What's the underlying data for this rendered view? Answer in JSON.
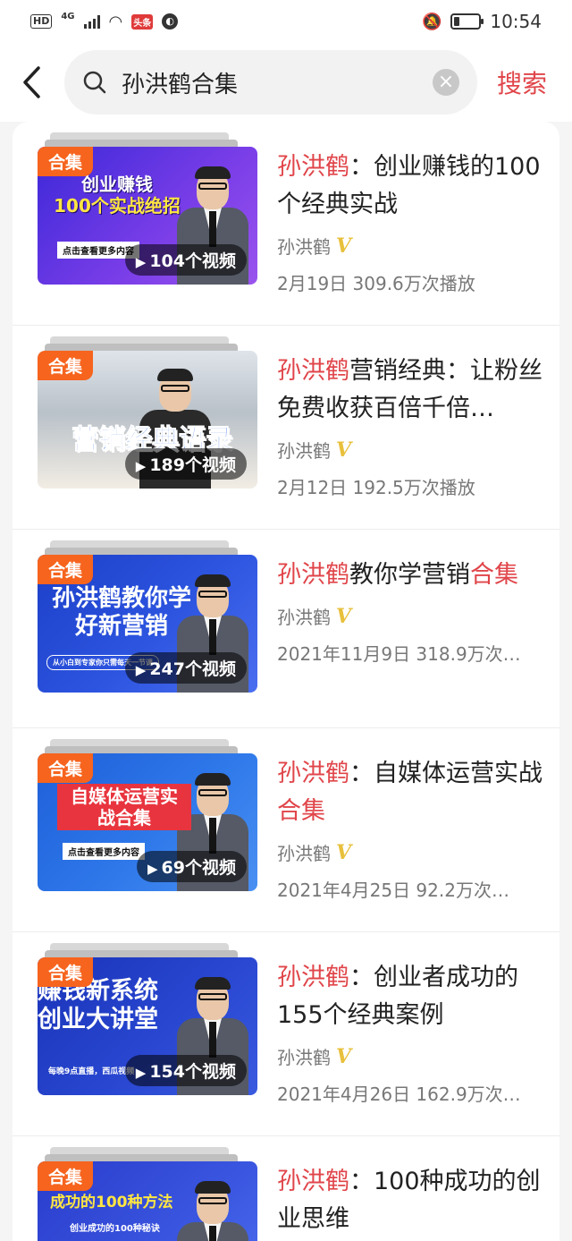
{
  "status_bar": {
    "hd": "HD",
    "network": "4G",
    "app_badge": "头条",
    "time": "10:54"
  },
  "search": {
    "query": "孙洪鹤合集",
    "clear_icon": "close-circle-icon",
    "button_label": "搜索"
  },
  "colors": {
    "accent": "#e0454a",
    "badge_orange": "#f6641e",
    "verified_gold": "#e8c03c"
  },
  "results": [
    {
      "badge": "合集",
      "thumb_lines": [
        "创业赚钱",
        "100个实战绝招"
      ],
      "thumb_sub": "点击查看更多内容",
      "count": "104个视频",
      "title_hl": "孙洪鹤",
      "title_rest": "：创业赚钱的100个经典实战",
      "title_hl2": "",
      "author": "孙洪鹤",
      "meta": "2月19日  309.6万次播放"
    },
    {
      "badge": "合集",
      "thumb_lines": [
        "营销经典语录"
      ],
      "thumb_sub": "",
      "count": "189个视频",
      "title_hl": "孙洪鹤",
      "title_rest": "营销经典：让粉丝免费收获百倍千倍…",
      "title_hl2": "",
      "author": "孙洪鹤",
      "meta": "2月12日  192.5万次播放"
    },
    {
      "badge": "合集",
      "thumb_lines": [
        "孙洪鹤教你学",
        "好新营销"
      ],
      "thumb_sub": "从小白到专家你只需每天一节课",
      "count": "247个视频",
      "title_hl": "孙洪鹤",
      "title_rest": "教你学营销",
      "title_hl2": "合集",
      "author": "孙洪鹤",
      "meta": "2021年11月9日  318.9万次…"
    },
    {
      "badge": "合集",
      "thumb_lines": [
        "自媒体运营实",
        "战合集"
      ],
      "thumb_sub": "点击查看更多内容",
      "count": "69个视频",
      "title_hl": "孙洪鹤",
      "title_rest": "：自媒体运营实战",
      "title_hl2": "合集",
      "author": "孙洪鹤",
      "meta": "2021年4月25日  92.2万次…"
    },
    {
      "badge": "合集",
      "thumb_lines": [
        "赚钱新系统",
        "创业大讲堂"
      ],
      "thumb_sub": "每晚9点直播，西瓜视频",
      "count": "154个视频",
      "title_hl": "孙洪鹤",
      "title_rest": "：创业者成功的155个经典案例",
      "title_hl2": "",
      "author": "孙洪鹤",
      "meta": "2021年4月26日  162.9万次…"
    },
    {
      "badge": "合集",
      "thumb_lines": [
        "成功的100种方法"
      ],
      "thumb_sub": "创业成功的100种秘诀",
      "count": "",
      "title_hl": "孙洪鹤",
      "title_rest": "：100种成功的创业思维",
      "title_hl2": "",
      "author": "",
      "meta": ""
    }
  ]
}
